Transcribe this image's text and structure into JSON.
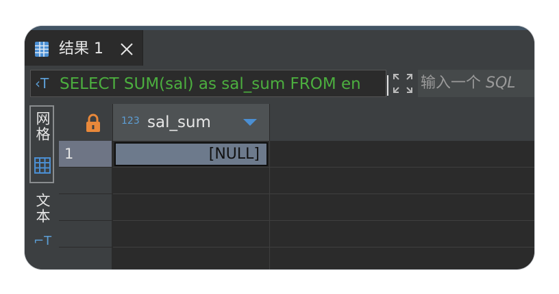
{
  "tab": {
    "label": "结果 1",
    "icon": "table-grid-icon",
    "close_icon": "close-icon"
  },
  "sql": {
    "text": "SELECT SUM(sal) as sal_sum FROM en",
    "icon": "sql-text-icon",
    "expand_icon": "expand-icon"
  },
  "filter": {
    "placeholder_prefix": "输入一个 ",
    "placeholder_italic": "SQL"
  },
  "sidebar": {
    "grid_label": "网格",
    "text_label": "文本"
  },
  "grid": {
    "column": {
      "type_badge": "123",
      "name": "sal_sum"
    },
    "rows": [
      {
        "num": "1",
        "value": "[NULL]"
      }
    ]
  },
  "colors": {
    "accent": "#4b8fd3",
    "sql_green": "#4caf3f",
    "selected_cell": "#6d7a8c",
    "lock": "#e8883a"
  }
}
